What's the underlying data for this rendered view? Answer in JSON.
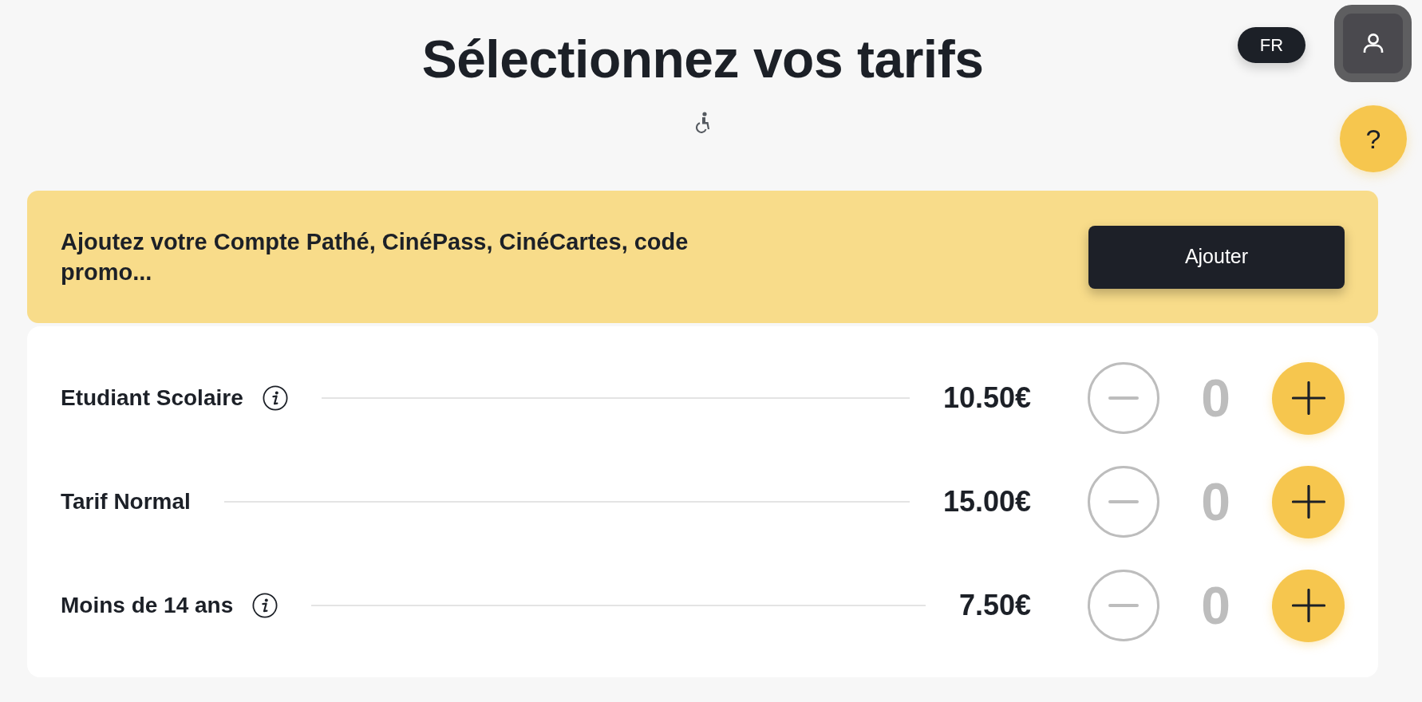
{
  "header": {
    "title": "Sélectionnez vos tarifs"
  },
  "top_controls": {
    "language": "FR",
    "help": "?"
  },
  "promo_banner": {
    "text": "Ajoutez votre Compte Pathé, CinéPass, CinéCartes, code promo...",
    "button": "Ajouter"
  },
  "tariffs": [
    {
      "name": "Etudiant Scolaire",
      "has_info": true,
      "price": "10.50€",
      "count": "0",
      "decrease_disabled": true
    },
    {
      "name": "Tarif Normal",
      "has_info": false,
      "price": "15.00€",
      "count": "0",
      "decrease_disabled": true
    },
    {
      "name": "Moins de 14 ans",
      "has_info": true,
      "price": "7.50€",
      "count": "0",
      "decrease_disabled": true
    }
  ]
}
